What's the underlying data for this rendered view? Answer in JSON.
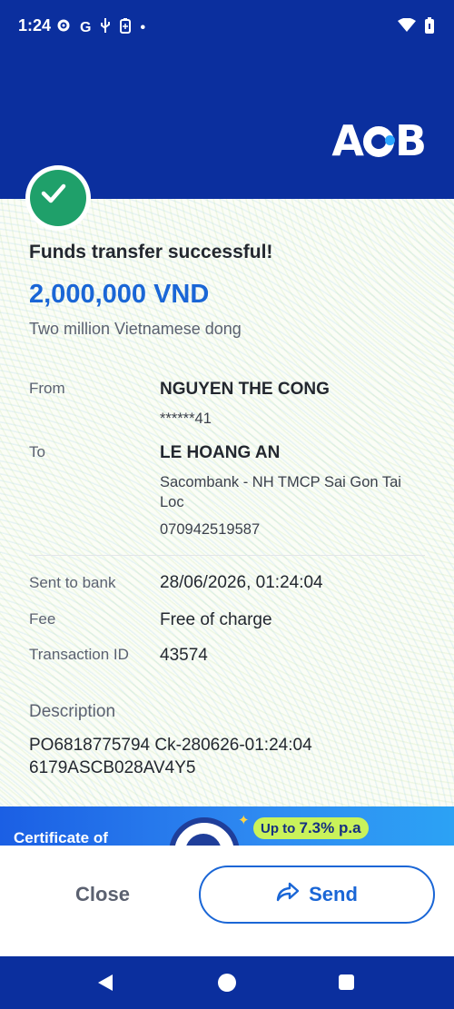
{
  "status_bar": {
    "time": "1:24",
    "icons": [
      "gear-icon",
      "google-icon",
      "usb-icon",
      "battery-saver-icon",
      "dot-icon",
      "wifi-icon",
      "battery-icon"
    ],
    "g_label": "G",
    "dot": "•"
  },
  "brand": {
    "logo_text": "ACB"
  },
  "result": {
    "title": "Funds transfer successful!",
    "amount": "2,000,000 VND",
    "amount_words": "Two million Vietnamese dong"
  },
  "details": {
    "from_label": "From",
    "from_name": "NGUYEN THE CONG",
    "from_account": "******41",
    "to_label": "To",
    "to_name": "LE HOANG AN",
    "to_bank": "Sacombank - NH TMCP Sai Gon Tai Loc",
    "to_account": "070942519587",
    "sent_label": "Sent to bank",
    "sent_value": "28/06/2026, 01:24:04",
    "fee_label": "Fee",
    "fee_value": "Free of charge",
    "txn_label": "Transaction ID",
    "txn_value": "43574",
    "desc_label": "Description",
    "desc_value": "PO6818775794 Ck-280626-01:24:04 6179ASCB028AV4Y5"
  },
  "banner": {
    "title": "Certificate of",
    "rate_prefix": "Up to",
    "rate_value": "7.3% p.a",
    "star": "✦"
  },
  "actions": {
    "close_label": "Close",
    "send_label": "Send"
  },
  "colors": {
    "brand_blue": "#0b2f9e",
    "accent_blue": "#1a66d6",
    "success_green": "#1fa06a"
  }
}
